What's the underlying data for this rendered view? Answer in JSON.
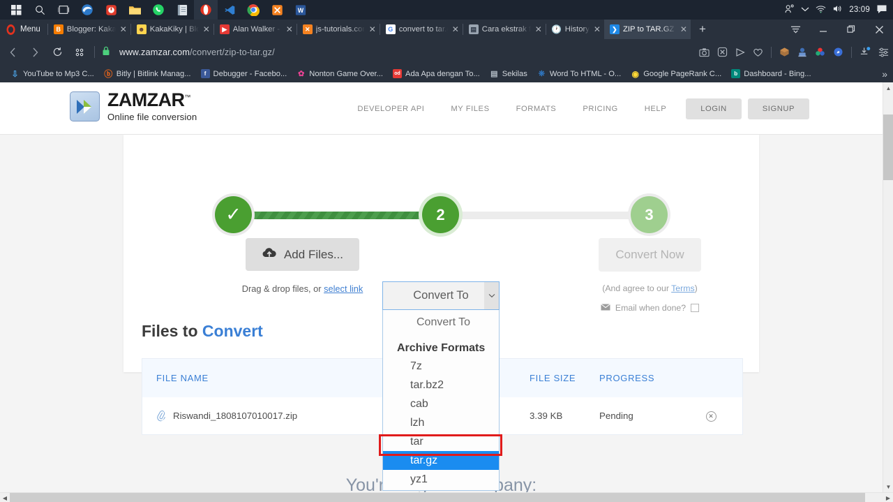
{
  "taskbar": {
    "clock": "23:09",
    "icons": [
      {
        "name": "start-windows-icon",
        "glyph": "⊞"
      },
      {
        "name": "search-icon",
        "glyph": "○"
      },
      {
        "name": "task-view-icon",
        "glyph": "▤"
      },
      {
        "name": "edge-icon",
        "glyph": "e"
      },
      {
        "name": "app-red-icon",
        "glyph": "◉"
      },
      {
        "name": "file-explorer-icon",
        "glyph": "▰"
      },
      {
        "name": "whatsapp-icon",
        "glyph": "✆"
      },
      {
        "name": "notepad-icon",
        "glyph": "▤"
      },
      {
        "name": "opera-icon",
        "glyph": "O"
      },
      {
        "name": "vscode-icon",
        "glyph": "◈"
      },
      {
        "name": "chrome-icon",
        "glyph": "◎"
      },
      {
        "name": "js-tutorials-icon",
        "glyph": "⌘"
      },
      {
        "name": "word-icon",
        "glyph": "W"
      }
    ],
    "tray": [
      {
        "name": "people-icon",
        "glyph": "人"
      },
      {
        "name": "chevron-up-icon",
        "glyph": "⌄"
      },
      {
        "name": "wifi-icon",
        "glyph": "◞"
      },
      {
        "name": "volume-icon",
        "glyph": "◀"
      },
      {
        "name": "notifications-icon",
        "glyph": "▤"
      }
    ]
  },
  "browser": {
    "menu_label": "Menu",
    "tabs": [
      {
        "title": "Blogger: KakaK",
        "favicon": "B",
        "favicon_color": "#f57c00",
        "active": false
      },
      {
        "title": "KakaKiky | Blog",
        "favicon": "K",
        "favicon_color": "#ffca28",
        "active": false
      },
      {
        "title": "Alan Walker - D",
        "favicon": "▶",
        "favicon_color": "#e53935",
        "active": false
      },
      {
        "title": "js-tutorials.com",
        "favicon": "⌘",
        "favicon_color": "#fb8c00",
        "active": false
      },
      {
        "title": "convert to tar.g",
        "favicon": "G",
        "favicon_color": "#ffffff",
        "active": false
      },
      {
        "title": "Cara ekstrak fil",
        "favicon": "▤",
        "favicon_color": "#9aa5b1",
        "active": false
      },
      {
        "title": "History",
        "favicon": "◷",
        "favicon_color": "#e8eaed",
        "active": false
      },
      {
        "title": "ZIP to TAR.GZ -",
        "favicon": "❯",
        "favicon_color": "#1e88e5",
        "active": true
      }
    ],
    "new_tab_label": "+",
    "window_controls": [
      {
        "name": "tab-menu-icon",
        "glyph": "⩲"
      },
      {
        "name": "minimize-button",
        "glyph": "―"
      },
      {
        "name": "maximize-button",
        "glyph": "❐"
      },
      {
        "name": "close-window-button",
        "glyph": "✕"
      }
    ],
    "nav": {
      "back": "❮",
      "forward": "❯",
      "reload": "⟳",
      "grid": "▦"
    },
    "url": "www.zamzar.com/convert/zip-to-tar.gz/",
    "url_domain": "www.zamzar.com",
    "url_path": "/convert/zip-to-tar.gz/",
    "lock_icon": "🔒",
    "toolbar_icons": [
      {
        "name": "snapshot-icon",
        "glyph": "⬓"
      },
      {
        "name": "adblock-icon",
        "glyph": "⊗"
      },
      {
        "name": "player-icon",
        "glyph": "▷"
      },
      {
        "name": "heart-icon",
        "glyph": "♡"
      },
      {
        "name": "extension-box-icon",
        "glyph": "◫"
      },
      {
        "name": "extension-blue-icon",
        "glyph": "▣"
      },
      {
        "name": "extension-color-icon",
        "glyph": "✦"
      },
      {
        "name": "extension-oval-icon",
        "glyph": "◍"
      },
      {
        "name": "downloads-icon",
        "glyph": "⤓"
      },
      {
        "name": "easy-setup-icon",
        "glyph": "☰"
      }
    ],
    "bookmarks": [
      {
        "label": "YouTube to Mp3 C...",
        "icon": "⬇",
        "color": "#2a6fb5"
      },
      {
        "label": "Bitly | Bitlink Manag...",
        "icon": "b",
        "color": "#e8651a"
      },
      {
        "label": "Debugger - Facebo...",
        "icon": "f",
        "color": "#3b5998"
      },
      {
        "label": "Nonton Game Over...",
        "icon": "✿",
        "color": "#7e57c2"
      },
      {
        "label": "Ada Apa dengan To...",
        "icon": "od",
        "color": "#e53935"
      },
      {
        "label": "Sekilas",
        "icon": "▤",
        "color": "#9aa5b1"
      },
      {
        "label": "Word To HTML - O...",
        "icon": "oʻ",
        "color": "#1565c0"
      },
      {
        "label": "Google PageRank C...",
        "icon": "◉",
        "color": "#fdd835"
      },
      {
        "label": "Dashboard - Bing...",
        "icon": "b",
        "color": "#00897b"
      }
    ],
    "bookmarks_overflow": "»"
  },
  "site": {
    "logo": {
      "name": "ZAMZAR",
      "trademark": "™",
      "tagline": "Online file conversion"
    },
    "nav": [
      "DEVELOPER API",
      "MY FILES",
      "FORMATS",
      "PRICING",
      "HELP"
    ],
    "login_label": "LOGIN",
    "signup_label": "SIGNUP"
  },
  "converter": {
    "steps": [
      {
        "label": "✓",
        "state": "done"
      },
      {
        "label": "2",
        "state": "current"
      },
      {
        "label": "3",
        "state": "upcoming"
      }
    ],
    "add_files_label": "Add Files...",
    "add_files_icon": "☁",
    "drag_prefix": "Drag & drop files, or ",
    "drag_link": "select link",
    "convert_now_label": "Convert Now",
    "agree_prefix": "(And agree to our ",
    "agree_link": "Terms",
    "agree_suffix": ")",
    "email_icon": "✉",
    "email_label": "Email when done?",
    "select": {
      "button_label": "Convert To",
      "caret": "⌄",
      "placeholder_option": "Convert To",
      "group_label": "Archive Formats",
      "options": [
        "7z",
        "tar.bz2",
        "cab",
        "lzh",
        "tar",
        "tar.gz",
        "yz1"
      ],
      "selected": "tar.gz",
      "highlight_color": "#1a8cf0",
      "outline_color": "#e01b1b"
    }
  },
  "files_section": {
    "title_plain": "Files to ",
    "title_accent": "Convert",
    "columns": [
      "FILE NAME",
      "FILE SIZE",
      "PROGRESS"
    ],
    "rows": [
      {
        "attachment_icon": "📎",
        "name": "Riswandi_1808107010017.zip",
        "size": "3.39 KB",
        "progress": "Pending",
        "remove_icon": "✕"
      }
    ]
  },
  "footer": {
    "good_company": "You're in good company:"
  },
  "scroll": {
    "up_arrow": "▲",
    "down_arrow": "▼",
    "left_arrow": "◀",
    "right_arrow": "▶"
  }
}
